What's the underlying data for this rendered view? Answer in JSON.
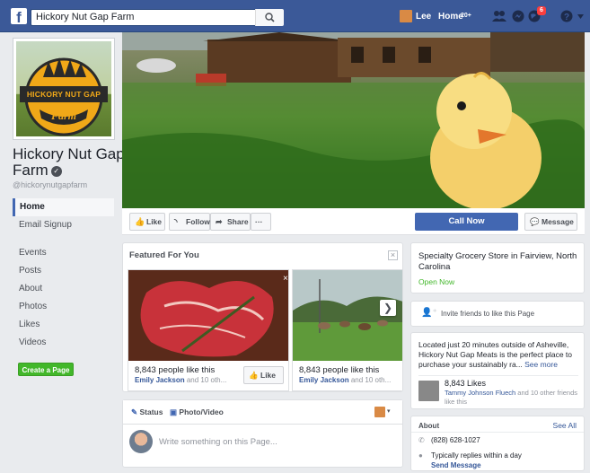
{
  "topbar": {
    "search_value": "Hickory Nut Gap Farm",
    "user_name": "Lee",
    "home_label": "Home",
    "home_badge": "20+",
    "notifications_count": "6"
  },
  "page": {
    "name": "Hickory Nut Gap Farm",
    "handle": "@hickorynutgapfarm",
    "logo_line1": "HICKORY NUT GAP",
    "logo_line2": "Farm"
  },
  "sidebar": {
    "items": [
      {
        "label": "Home"
      },
      {
        "label": "Email Signup"
      },
      {
        "label": "Events"
      },
      {
        "label": "Posts"
      },
      {
        "label": "About"
      },
      {
        "label": "Photos"
      },
      {
        "label": "Likes"
      },
      {
        "label": "Videos"
      }
    ],
    "create_page": "Create a Page"
  },
  "actions": {
    "like": "Like",
    "follow": "Follow",
    "share": "Share",
    "more": "···",
    "call_now": "Call Now",
    "message": "Message"
  },
  "featured": {
    "title": "Featured For You",
    "items": [
      {
        "likes": "8,843 people like this",
        "friend_name": "Emily Jackson",
        "friend_rest": " and 10 oth...",
        "like_label": "Like"
      },
      {
        "likes": "8,843 people like this",
        "friend_name": "Emily Jackson",
        "friend_rest": " and 10 oth..."
      }
    ]
  },
  "composer": {
    "status_tab": "Status",
    "photo_tab": "Photo/Video",
    "placeholder": "Write something on this Page..."
  },
  "business": {
    "type": "Specialty Grocery Store in Fairview, North Carolina",
    "open_status": "Open Now"
  },
  "invite": {
    "text": "Invite friends to like this Page"
  },
  "description": {
    "text": "Located just 20 minutes outside of Asheville, Hickory Nut Gap Meats is the perfect place to purchase your sustainably ra...",
    "see_more": "See more",
    "likes_count": "8,843 Likes",
    "friend_name": "Tammy Johnson Fluech",
    "friend_rest": " and 10 other friends like this"
  },
  "about": {
    "title": "About",
    "see_all": "See All",
    "phone": "(828) 628-1027",
    "reply": "Typically replies within a day",
    "send_message": "Send Message"
  },
  "colors": {
    "facebook_blue": "#3b5998",
    "button_blue": "#4267b2",
    "green": "#42b72a"
  }
}
